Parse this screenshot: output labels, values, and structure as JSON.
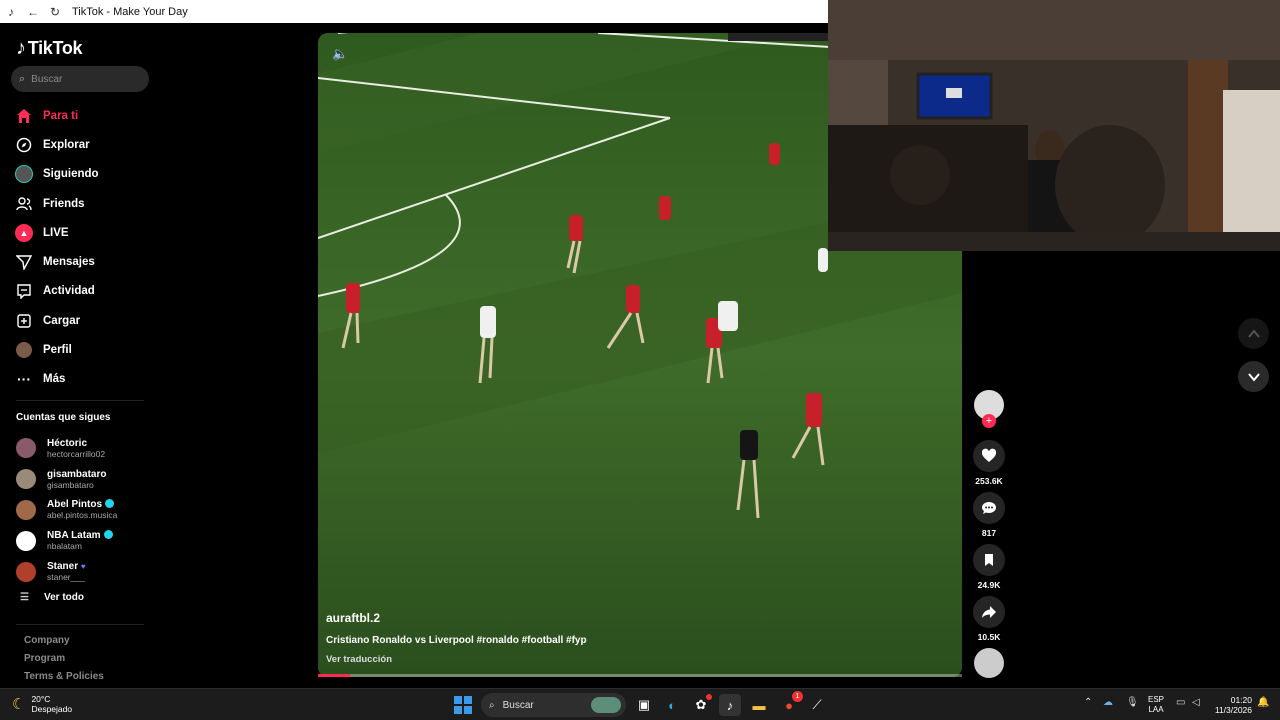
{
  "window": {
    "title": "TikTok - Make Your Day"
  },
  "sidebar": {
    "logo": "TikTok",
    "search_placeholder": "Buscar",
    "nav": [
      {
        "label": "Para ti",
        "icon": "home-icon"
      },
      {
        "label": "Explorar",
        "icon": "compass-icon"
      },
      {
        "label": "Siguiendo",
        "icon": "following-avatar-icon"
      },
      {
        "label": "Friends",
        "icon": "friends-icon"
      },
      {
        "label": "LIVE",
        "icon": "live-icon"
      },
      {
        "label": "Mensajes",
        "icon": "send-icon"
      },
      {
        "label": "Actividad",
        "icon": "activity-icon"
      },
      {
        "label": "Cargar",
        "icon": "upload-icon"
      },
      {
        "label": "Perfil",
        "icon": "profile-avatar-icon"
      },
      {
        "label": "Más",
        "icon": "more-icon"
      }
    ],
    "following_title": "Cuentas que sigues",
    "following": [
      {
        "name": "Héctoric",
        "user": "hectorcarrillo02",
        "verified": false
      },
      {
        "name": "gisambataro",
        "user": "gisambataro",
        "verified": false
      },
      {
        "name": "Abel Pintos",
        "user": "abel.pintos.musica",
        "verified": true
      },
      {
        "name": "NBA Latam",
        "user": "nbalatam",
        "verified": true
      },
      {
        "name": "Staner",
        "user": "staner___",
        "verified": false
      }
    ],
    "see_all": "Ver todo",
    "footer": [
      "Company",
      "Program",
      "Terms & Policies"
    ]
  },
  "video": {
    "username": "auraftbl.2",
    "description": "Cristiano Ronaldo vs Liverpool #ronaldo #football #fyp",
    "translate": "Ver traducción",
    "progress": 0.05
  },
  "actions": {
    "likes": "253.6K",
    "comments": "817",
    "saves": "24.9K",
    "shares": "10.5K"
  },
  "taskbar": {
    "temp": "20°C",
    "weather": "Despejado",
    "search": "Buscar",
    "lang1": "ESP",
    "lang2": "LAA",
    "time": "01:20",
    "date": "11/3/2026",
    "badge_count": "1"
  },
  "colors": {
    "accent": "#fe2c55",
    "verified": "#20d5ec"
  }
}
